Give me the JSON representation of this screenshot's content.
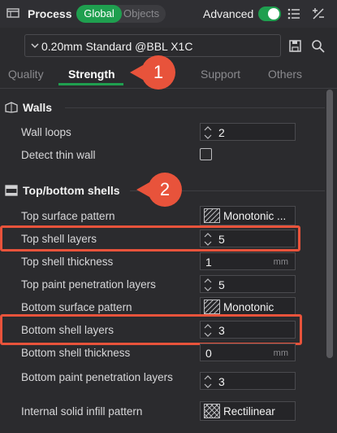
{
  "header": {
    "title": "Process",
    "global_label": "Global",
    "objects_label": "Objects",
    "advanced_label": "Advanced",
    "advanced_on": true
  },
  "preset": {
    "name": "0.20mm Standard @BBL X1C"
  },
  "tabs": [
    {
      "label": "Quality",
      "active": false
    },
    {
      "label": "Strength",
      "active": true
    },
    {
      "label": "Support",
      "active": false
    },
    {
      "label": "Others",
      "active": false
    }
  ],
  "badges": [
    "1",
    "2"
  ],
  "sections": {
    "walls": {
      "title": "Walls",
      "wall_loops": {
        "label": "Wall loops",
        "value": "2"
      },
      "detect_thin_wall": {
        "label": "Detect thin wall",
        "checked": false
      }
    },
    "top_bottom": {
      "title": "Top/bottom shells",
      "top_surface_pattern": {
        "label": "Top surface pattern",
        "value": "Monotonic ..."
      },
      "top_shell_layers": {
        "label": "Top shell layers",
        "value": "5"
      },
      "top_shell_thickness": {
        "label": "Top shell thickness",
        "value": "1",
        "unit": "mm"
      },
      "top_paint_penetration": {
        "label": "Top paint penetration layers",
        "value": "5"
      },
      "bottom_surface_pattern": {
        "label": "Bottom surface pattern",
        "value": "Monotonic"
      },
      "bottom_shell_layers": {
        "label": "Bottom shell layers",
        "value": "3"
      },
      "bottom_shell_thickness": {
        "label": "Bottom shell thickness",
        "value": "0",
        "unit": "mm"
      },
      "bottom_paint_penetration": {
        "label": "Bottom paint penetration layers",
        "value": "3"
      },
      "internal_solid_infill_pattern": {
        "label": "Internal solid infill pattern",
        "value": "Rectilinear"
      }
    }
  },
  "colors": {
    "accent_green": "#1f9f4f",
    "annotation_red": "#e8533b",
    "background": "#2b2b2e"
  },
  "icons": [
    "process-icon",
    "list-icon",
    "compare-icon",
    "chevron-down-icon",
    "save-icon",
    "search-icon",
    "walls-icon",
    "shells-icon",
    "spin-arrows-icon",
    "monotonic-pattern-icon",
    "rectilinear-pattern-icon"
  ]
}
